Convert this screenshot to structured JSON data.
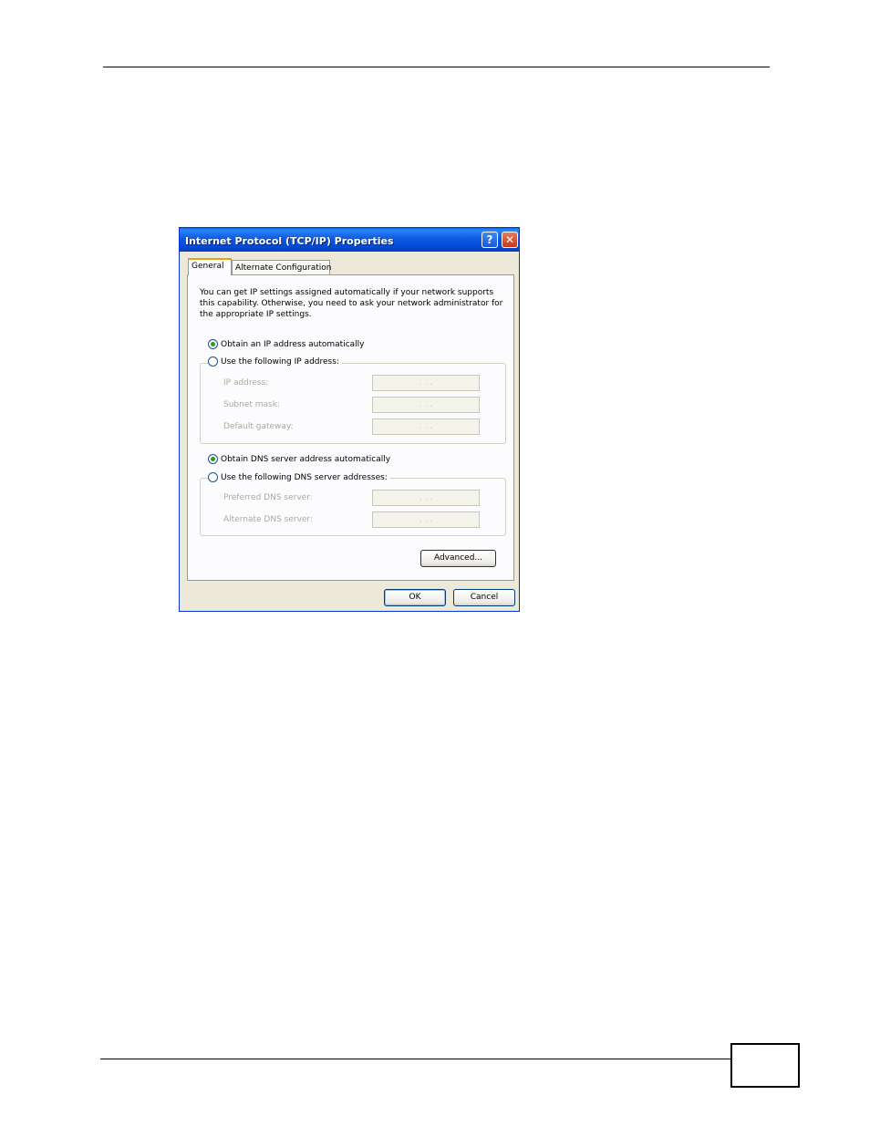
{
  "dialog": {
    "title": "Internet Protocol (TCP/IP) Properties",
    "help_glyph": "?",
    "close_glyph": "✕",
    "tabs": [
      {
        "label": "General",
        "active": true
      },
      {
        "label": "Alternate Configuration",
        "active": false
      }
    ],
    "description": "You can get IP settings assigned automatically if your network supports this capability. Otherwise, you need to ask your network administrator for the appropriate IP settings.",
    "ip_section": {
      "auto_label": "Obtain an IP address automatically",
      "auto_selected": true,
      "manual_label": "Use the following IP address:",
      "manual_selected": false,
      "fields": [
        {
          "label": "IP address:",
          "value": ".   .   ."
        },
        {
          "label": "Subnet mask:",
          "value": ".   .   ."
        },
        {
          "label": "Default gateway:",
          "value": ".   .   ."
        }
      ]
    },
    "dns_section": {
      "auto_label": "Obtain DNS server address automatically",
      "auto_selected": true,
      "manual_label": "Use the following DNS server addresses:",
      "manual_selected": false,
      "fields": [
        {
          "label": "Preferred DNS server:",
          "value": ".   .   ."
        },
        {
          "label": "Alternate DNS server:",
          "value": ".   .   ."
        }
      ]
    },
    "buttons": {
      "advanced": "Advanced...",
      "ok": "OK",
      "cancel": "Cancel"
    }
  }
}
